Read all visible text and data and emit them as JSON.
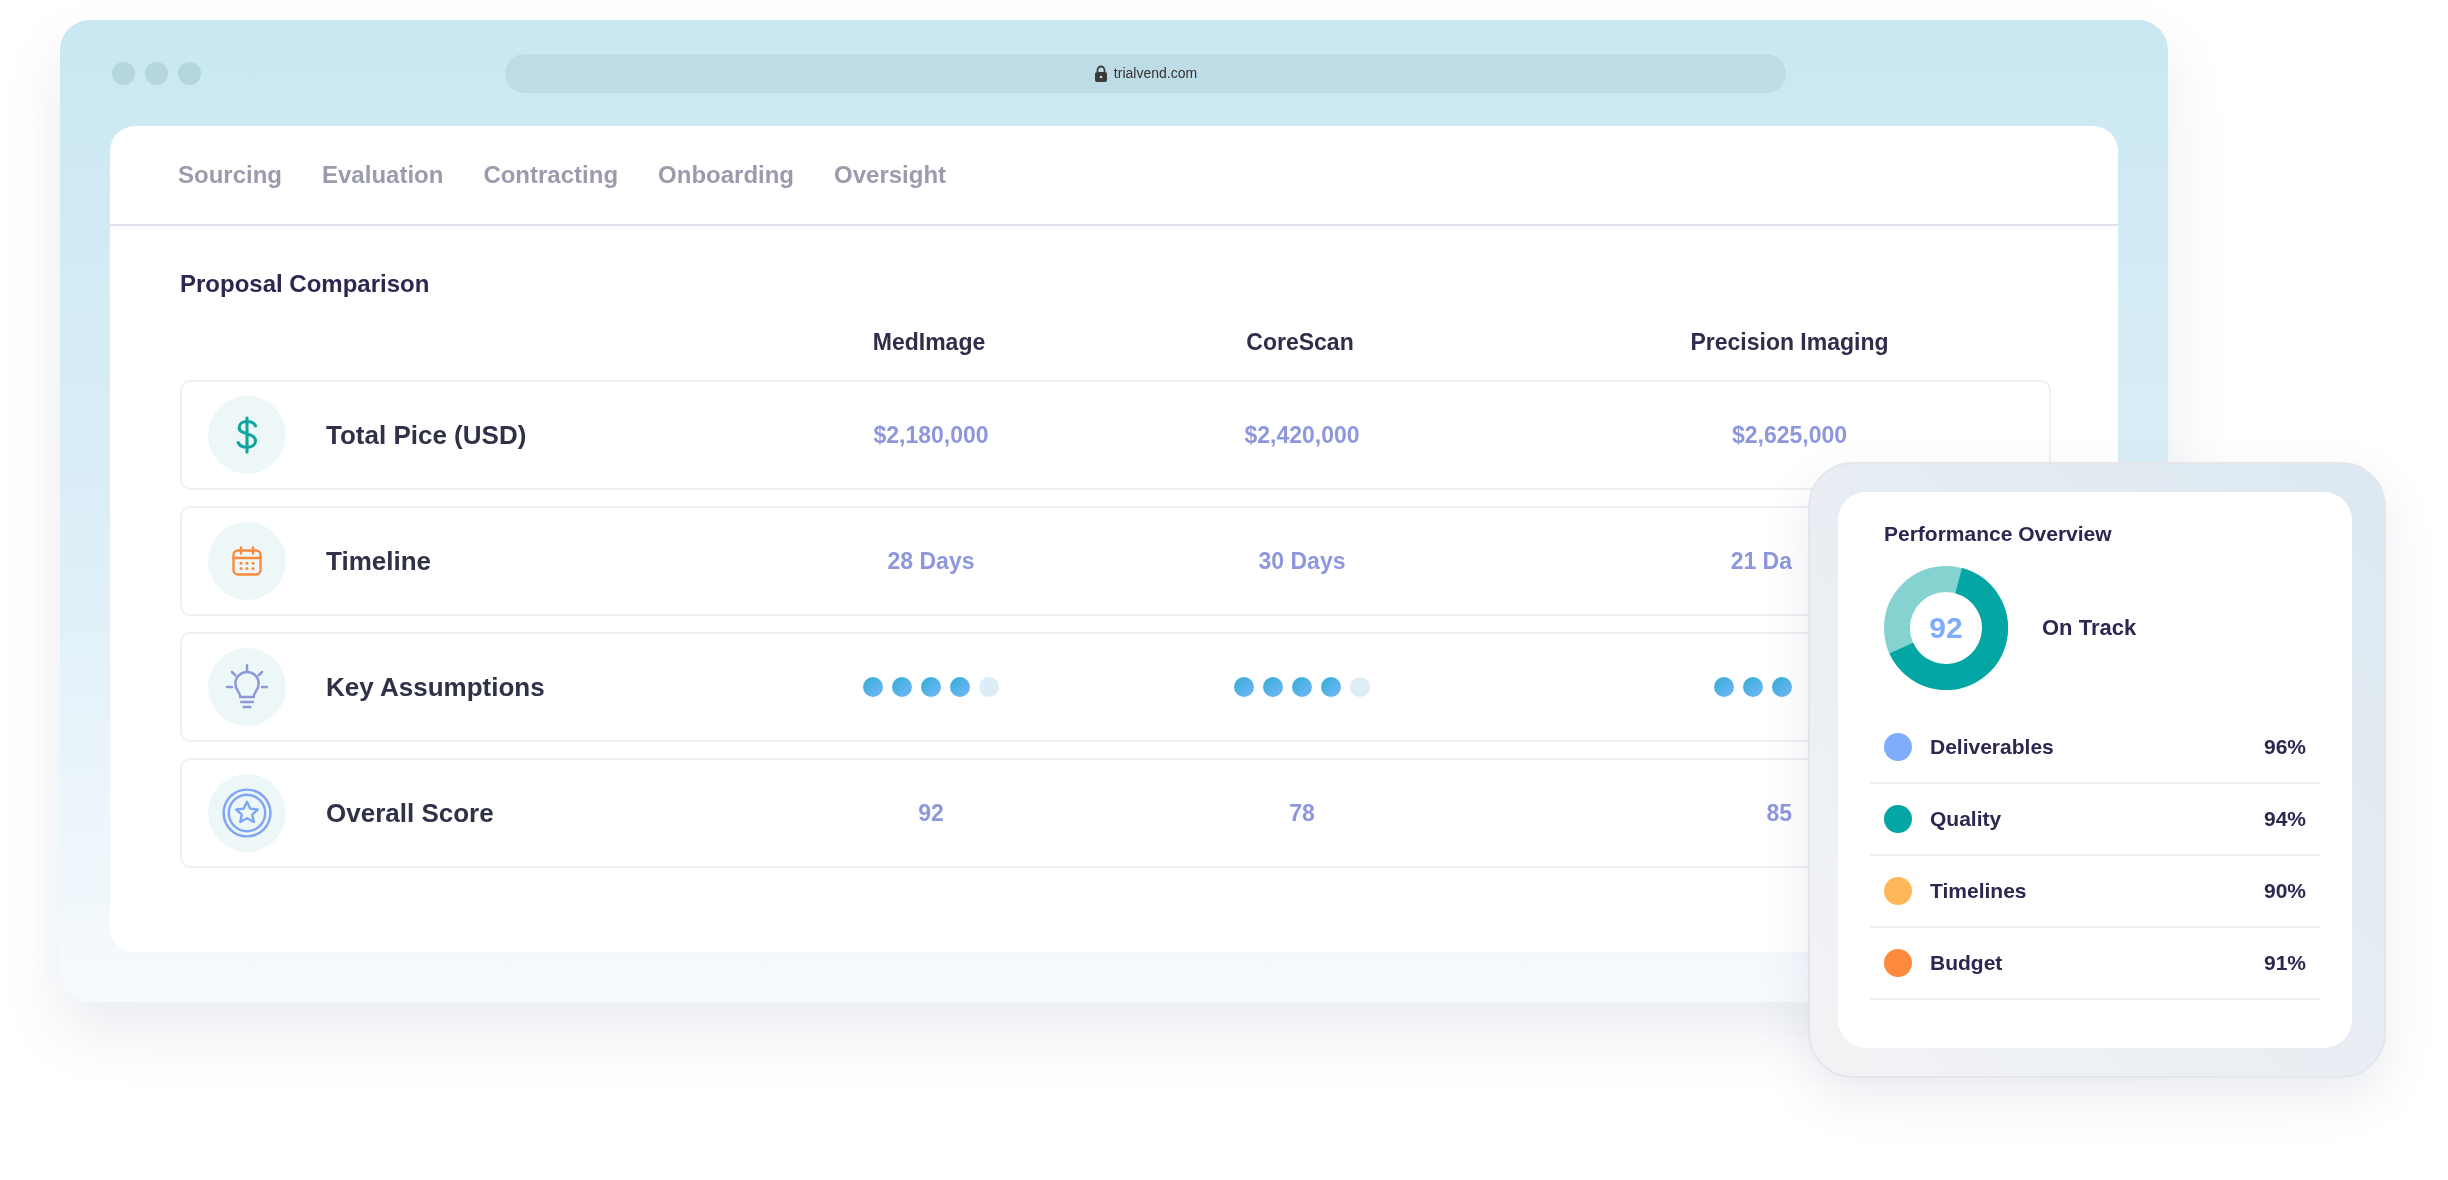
{
  "browser": {
    "url": "trialvend.com"
  },
  "tabs": [
    {
      "label": "Sourcing",
      "selected": false
    },
    {
      "label": "Evaluation",
      "selected": false
    },
    {
      "label": "Contracting",
      "selected": false
    },
    {
      "label": "Onboarding",
      "selected": false
    },
    {
      "label": "Oversight",
      "selected": false
    }
  ],
  "comparison": {
    "title": "Proposal Comparison",
    "columns": [
      "MedImage",
      "CoreScan",
      "Precision Imaging"
    ],
    "rows": [
      {
        "kind": "text",
        "label": "Total Pice (USD)",
        "cells": [
          {
            "text": "$2,180,000",
            "clipped": false
          },
          {
            "text": "$2,420,000",
            "clipped": false
          },
          {
            "text": "$2,625,000",
            "clipped": false
          }
        ]
      },
      {
        "kind": "text",
        "label": "Timeline",
        "cells": [
          {
            "text": "28 Days",
            "clipped": false
          },
          {
            "text": "30 Days",
            "clipped": false
          },
          {
            "text": "21 Da",
            "clipped": true
          }
        ]
      },
      {
        "kind": "rating",
        "label": "Key Assumptions",
        "cells": [
          {
            "stars": 4,
            "clipped": false
          },
          {
            "stars": 4,
            "clipped": false
          },
          {
            "stars": 3,
            "clipped": true
          }
        ]
      },
      {
        "kind": "text",
        "label": "Overall Score",
        "cells": [
          {
            "text": "92",
            "clipped": false
          },
          {
            "text": "78",
            "clipped": false
          },
          {
            "text": "85",
            "clipped": true
          }
        ]
      }
    ]
  },
  "performance": {
    "title": "Performance Overview",
    "score": "92",
    "status": "On Track",
    "metrics": [
      {
        "label": "Deliverables",
        "value": "96%",
        "color": "#7fadfc"
      },
      {
        "label": "Quality",
        "value": "94%",
        "color": "#03a6a4"
      },
      {
        "label": "Timelines",
        "value": "90%",
        "color": "#feb85a"
      },
      {
        "label": "Budget",
        "value": "91%",
        "color": "#fe8a3d"
      }
    ]
  }
}
